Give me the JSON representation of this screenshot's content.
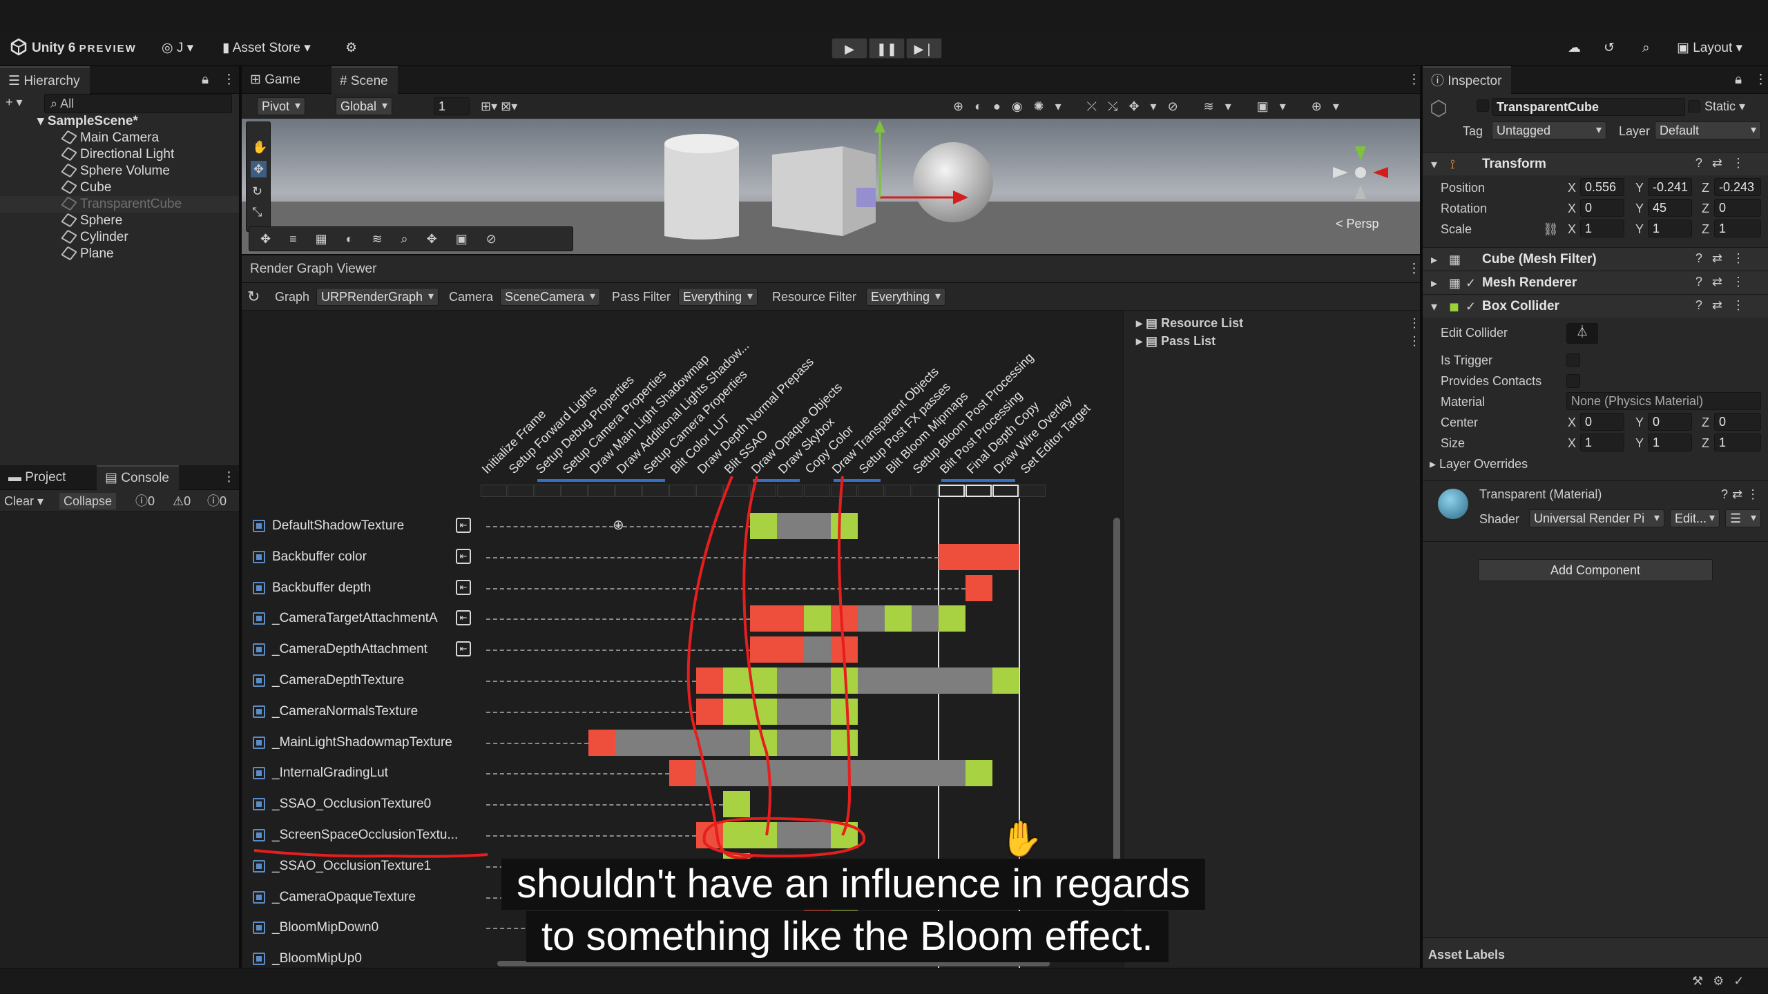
{
  "app": {
    "title": "Unity 6",
    "title_suffix": "PREVIEW",
    "account": "J",
    "asset_store": "Asset Store",
    "layout": "Layout"
  },
  "hierarchy": {
    "tab": "Hierarchy",
    "search_placeholder": "All",
    "scene": "SampleScene*",
    "items": [
      "Main Camera",
      "Directional Light",
      "Sphere Volume",
      "Cube",
      "TransparentCube",
      "Sphere",
      "Cylinder",
      "Plane"
    ]
  },
  "bottom_left": {
    "tab_project": "Project",
    "tab_console": "Console",
    "clear": "Clear",
    "collapse": "Collapse",
    "count_info": "0",
    "count_warn": "0",
    "count_error": "0"
  },
  "scene": {
    "tab_game": "Game",
    "tab_scene": "Scene",
    "pivot": "Pivot",
    "global": "Global",
    "grid_value": "1",
    "persp": "Persp"
  },
  "render_graph": {
    "title": "Render Graph Viewer",
    "graph_label": "Graph",
    "graph_value": "URPRenderGraph",
    "camera_label": "Camera",
    "camera_value": "SceneCamera",
    "pass_filter_label": "Pass Filter",
    "pass_filter_value": "Everything",
    "resource_filter_label": "Resource Filter",
    "resource_filter_value": "Everything",
    "resource_list": "Resource List",
    "pass_list": "Pass List",
    "passes": [
      "Initialize Frame",
      "Setup Forward Lights",
      "Setup Debug Properties",
      "Setup Camera Properties",
      "Draw Main Light Shadowmap",
      "Draw Additional Lights Shadow...",
      "Setup Camera Properties",
      "Blit Color LUT",
      "Draw Depth Normal Prepass",
      "Blit SSAO",
      "Draw Opaque Objects",
      "Draw Skybox",
      "Copy Color",
      "Draw Transparent Objects",
      "Setup Post FX passes",
      "Blit Bloom Mipmaps",
      "Setup Bloom Post Processing",
      "Blit Post Processing",
      "Final Depth Copy",
      "Draw Wire Overlay",
      "Set Editor Target"
    ],
    "resources": [
      "DefaultShadowTexture",
      "Backbuffer color",
      "Backbuffer depth",
      "_CameraTargetAttachmentA",
      "_CameraDepthAttachment",
      "_CameraDepthTexture",
      "_CameraNormalsTexture",
      "_MainLightShadowmapTexture",
      "_InternalGradingLut",
      "_SSAO_OcclusionTexture0",
      "_ScreenSpaceOcclusionTextu...",
      "_SSAO_OcclusionTexture1",
      "_CameraOpaqueTexture",
      "_BloomMipDown0",
      "_BloomMipUp0"
    ]
  },
  "inspector": {
    "tab": "Inspector",
    "object_name": "TransparentCube",
    "static": "Static",
    "tag_label": "Tag",
    "tag_value": "Untagged",
    "layer_label": "Layer",
    "layer_value": "Default",
    "transform": "Transform",
    "position_label": "Position",
    "rotation_label": "Rotation",
    "scale_label": "Scale",
    "position": {
      "x": "0.556",
      "y": "-0.241",
      "z": "-0.243"
    },
    "rotation": {
      "x": "0",
      "y": "45",
      "z": "0"
    },
    "scale": {
      "x": "1",
      "y": "1",
      "z": "1"
    },
    "mesh_filter": "Cube (Mesh Filter)",
    "mesh_renderer": "Mesh Renderer",
    "box_collider": "Box Collider",
    "edit_collider": "Edit Collider",
    "is_trigger": "Is Trigger",
    "provides_contacts": "Provides Contacts",
    "material_label": "Material",
    "material_value": "None (Physics Material)",
    "center_label": "Center",
    "center": {
      "x": "0",
      "y": "0",
      "z": "0"
    },
    "size_label": "Size",
    "size": {
      "x": "1",
      "y": "1",
      "z": "1"
    },
    "layer_overrides": "Layer Overrides",
    "material_name": "Transparent (Material)",
    "shader_label": "Shader",
    "shader_value": "Universal Render Pi",
    "edit_btn": "Edit...",
    "add_component": "Add Component",
    "asset_labels": "Asset Labels"
  },
  "subtitle": {
    "line1": "shouldn't have an influence in regards",
    "line2": "to something like the Bloom effect."
  },
  "colors": {
    "green": "#a8d241",
    "red": "#ee4e3c",
    "gray": "#7e7e7e",
    "annotation": "#e61e1e"
  }
}
